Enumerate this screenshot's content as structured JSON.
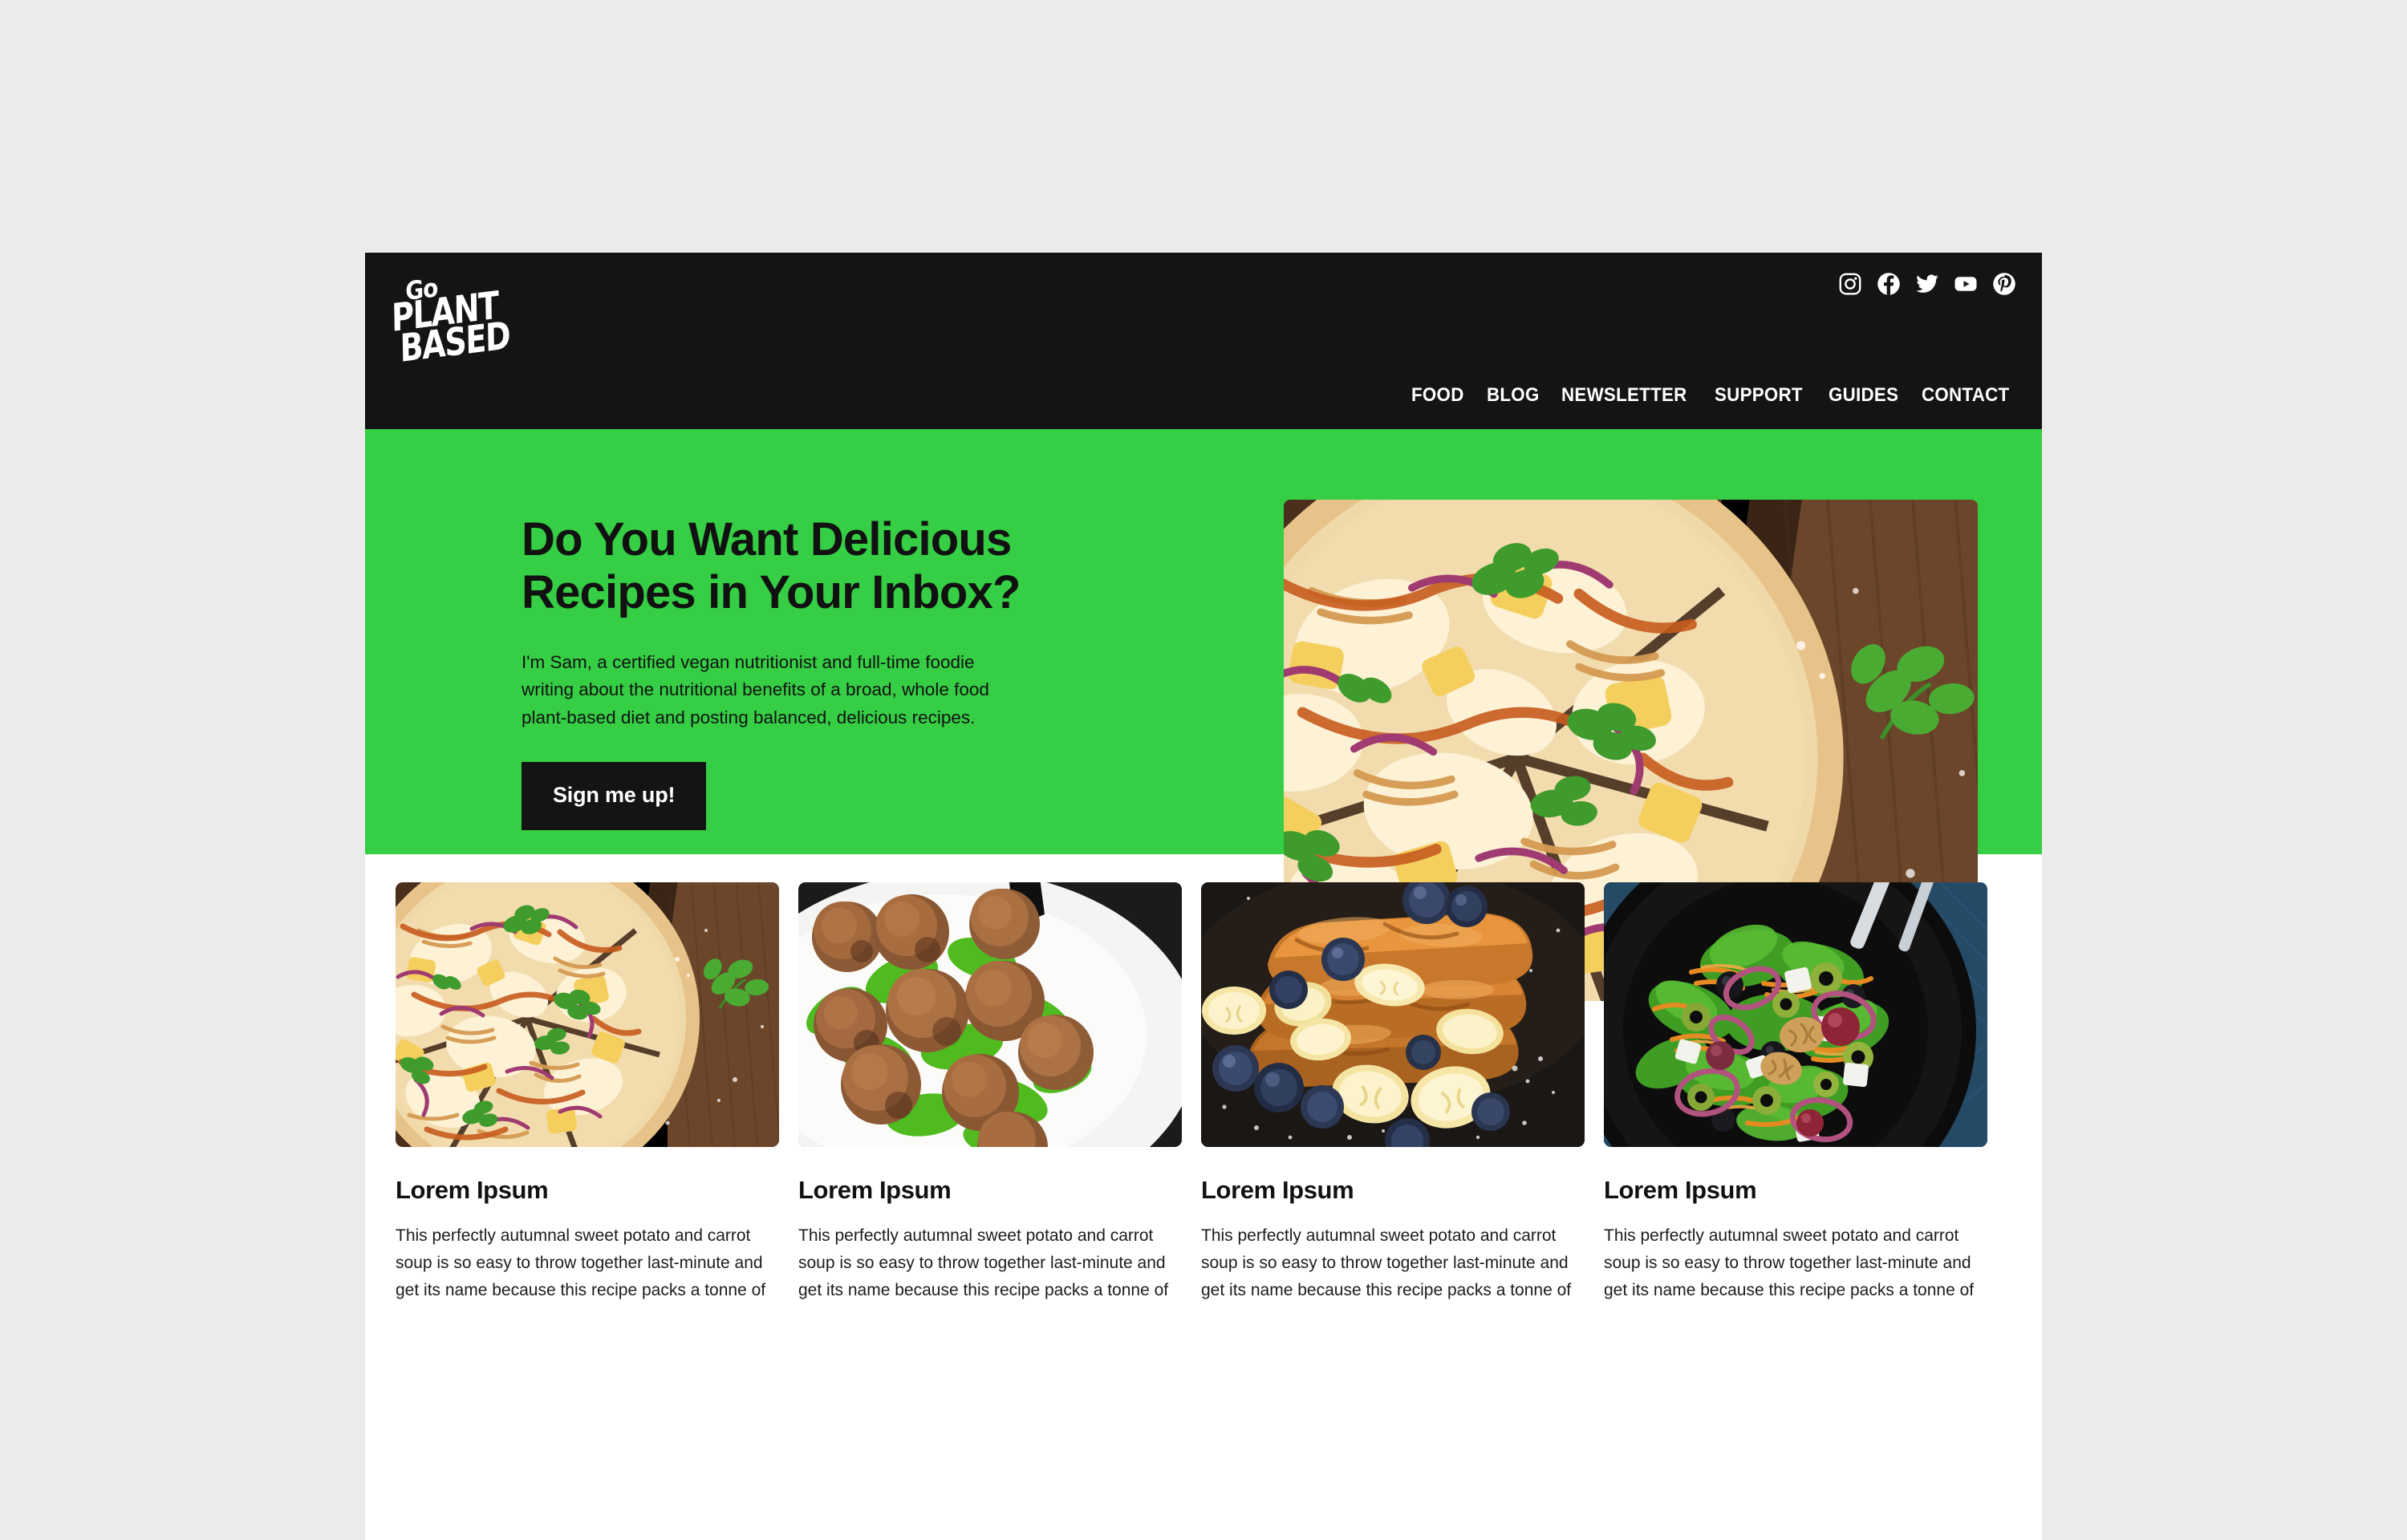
{
  "theme": {
    "page_background": "#ebebeb",
    "header_background": "#141414",
    "hero_background": "#35ce45",
    "cards_background": "#ffffff",
    "text_dark": "#111111",
    "text_light": "#ffffff",
    "accent_green": "#35ce45"
  },
  "header": {
    "logo": {
      "line1": "Go",
      "line2": "PLANT",
      "line3": "BASED",
      "full_text": "Go PLANT BASED"
    },
    "social": [
      {
        "name": "instagram-icon",
        "label": "Instagram"
      },
      {
        "name": "facebook-icon",
        "label": "Facebook"
      },
      {
        "name": "twitter-icon",
        "label": "Twitter"
      },
      {
        "name": "youtube-icon",
        "label": "YouTube"
      },
      {
        "name": "pinterest-icon",
        "label": "Pinterest"
      }
    ],
    "nav": [
      {
        "label": "FOOD"
      },
      {
        "label": "BLOG"
      },
      {
        "label": "NEWSLETTER"
      },
      {
        "label": "SUPPORT"
      },
      {
        "label": "GUIDES"
      },
      {
        "label": "CONTACT"
      }
    ]
  },
  "hero": {
    "title": "Do You Want Delicious Recipes in Your Inbox?",
    "subtitle": "I'm Sam, a certified vegan nutritionist and full-time foodie writing about the nutritional benefits of a broad, whole food plant-based diet and posting balanced, delicious recipes.",
    "cta_label": "Sign me up!",
    "image_alt": "BBQ chicken and pineapple pizza sliced on a wooden board with coriander"
  },
  "cards": [
    {
      "title": "Lorem Ipsum",
      "body": "This perfectly autumnal sweet potato and carrot soup is so easy to throw together last-minute and get its name because this recipe packs a tonne of",
      "image_alt": "BBQ chicken and pineapple pizza on a wooden board"
    },
    {
      "title": "Lorem Ipsum",
      "body": "This perfectly autumnal sweet potato and carrot soup is so easy to throw together last-minute and get its name because this recipe packs a tonne of",
      "image_alt": "Meatballs on a bed of rocket leaves on a white plate with a fork"
    },
    {
      "title": "Lorem Ipsum",
      "body": "This perfectly autumnal sweet potato and carrot soup is so easy to throw together last-minute and get its name because this recipe packs a tonne of",
      "image_alt": "Stack of French toast with banana slices and blueberries dusted with icing sugar"
    },
    {
      "title": "Lorem Ipsum",
      "body": "This perfectly autumnal sweet potato and carrot soup is so easy to throw together last-minute and get its name because this recipe packs a tonne of",
      "image_alt": "Green salad with carrot, olives, red onion and walnuts on a black plate with a fork on blue linen"
    }
  ]
}
